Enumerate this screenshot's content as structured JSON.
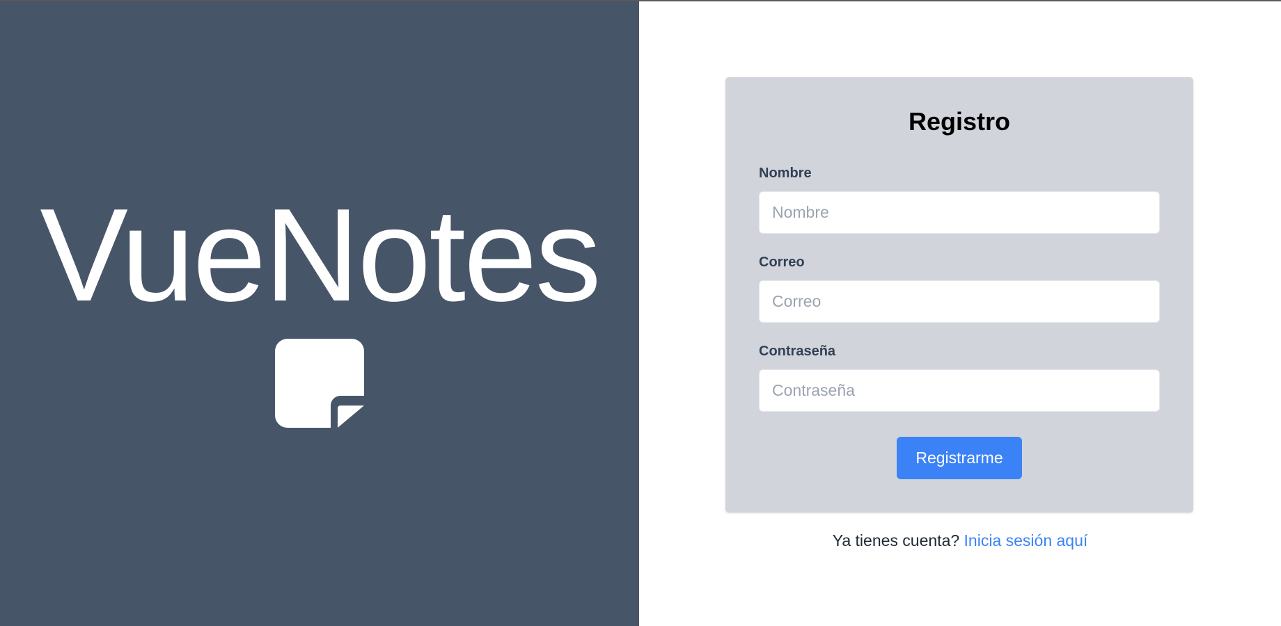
{
  "brand": {
    "name": "VueNotes",
    "icon": "sticky-note-icon",
    "background_color": "#475569",
    "foreground_color": "#ffffff"
  },
  "form": {
    "title": "Registro",
    "fields": [
      {
        "label": "Nombre",
        "placeholder": "Nombre",
        "value": "",
        "type": "text"
      },
      {
        "label": "Correo",
        "placeholder": "Correo",
        "value": "",
        "type": "email"
      },
      {
        "label": "Contraseña",
        "placeholder": "Contraseña",
        "value": "",
        "type": "password"
      }
    ],
    "submit_label": "Registrarme",
    "card_color": "#d1d5db",
    "accent_color": "#3b82f6"
  },
  "footer": {
    "prompt_text": "Ya tienes cuenta?",
    "login_link_text": "Inicia sesión aquí"
  }
}
